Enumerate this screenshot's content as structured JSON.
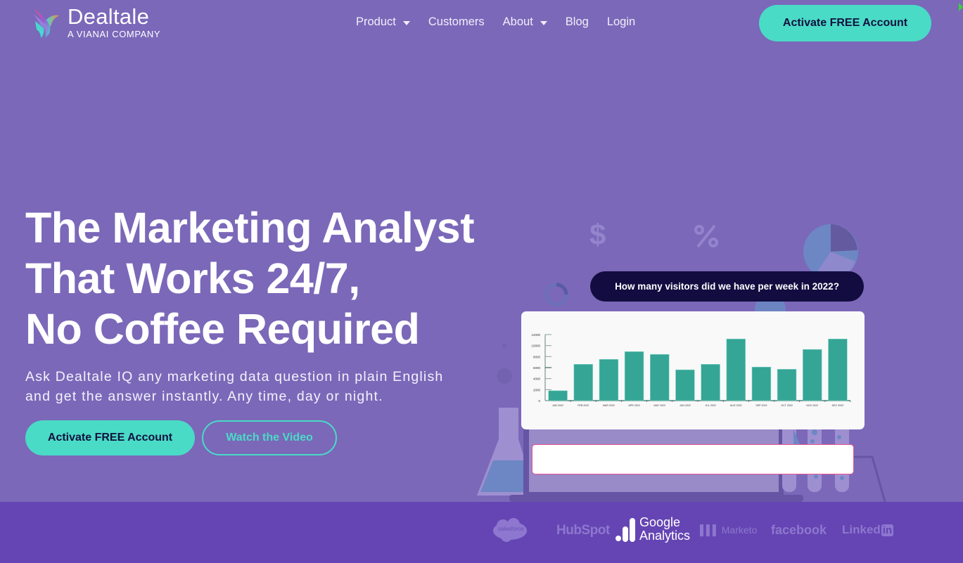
{
  "brand": {
    "name": "Dealtale",
    "tagline": "A VIANAI COMPANY",
    "colors": {
      "background": "#7b68b9",
      "accent": "#49dbc6",
      "navy": "#120c40",
      "footer": "#6545b3",
      "bar": "#35a595"
    }
  },
  "nav": {
    "items": [
      {
        "label": "Product",
        "has_dropdown": true
      },
      {
        "label": "Customers",
        "has_dropdown": false
      },
      {
        "label": "About",
        "has_dropdown": true
      },
      {
        "label": "Blog",
        "has_dropdown": false
      },
      {
        "label": "Login",
        "has_dropdown": false
      }
    ],
    "cta_label": "Activate FREE Account"
  },
  "hero": {
    "title_lines": [
      "The Marketing Analyst",
      "That Works 24/7,",
      "No Coffee Required"
    ],
    "subtitle_lines": [
      "Ask Dealtale IQ any marketing data question in plain English",
      "and get the answer instantly. Any time, day or night."
    ],
    "primary_cta": "Activate FREE Account",
    "secondary_cta": "Watch the Video"
  },
  "illustration": {
    "question": "How many visitors did we have per week in 2022?",
    "input_value": "",
    "decor_icons": [
      "dollar-icon",
      "percent-icon",
      "pie-chart-icon",
      "donut-icon",
      "flask-icon",
      "test-tubes-icon",
      "laptop-icon"
    ]
  },
  "chart_data": {
    "type": "bar",
    "title": "",
    "xlabel": "",
    "ylabel": "",
    "categories": [
      "JAN 2022",
      "FEB 2022",
      "MAR 2022",
      "APR 2022",
      "MAY 2022",
      "JUN 2022",
      "JUL 2022",
      "AUG 2022",
      "SEP 2022",
      "OCT 2022",
      "NOV 2022",
      "DEC 2022"
    ],
    "values": [
      1800,
      6600,
      7500,
      8900,
      8400,
      5600,
      6600,
      11200,
      6100,
      5700,
      9300,
      11200
    ],
    "yticks": [
      0,
      2000,
      4000,
      6000,
      8000,
      10000,
      12000
    ],
    "ylim": [
      0,
      12000
    ],
    "grid": false,
    "legend": "none"
  },
  "partners": [
    "salesforce",
    "HubSpot",
    "Google Analytics",
    "Marketo",
    "facebook",
    "LinkedIn"
  ]
}
